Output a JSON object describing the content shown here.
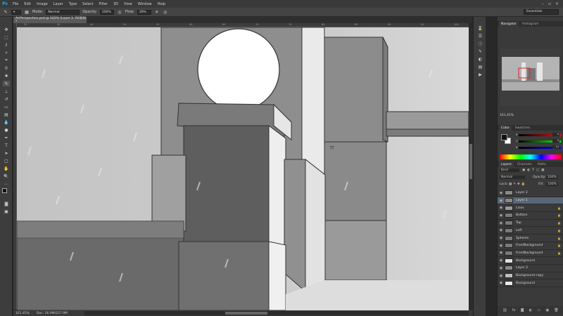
{
  "menubar": {
    "logo": "Ps",
    "items": [
      "File",
      "Edit",
      "Image",
      "Layer",
      "Type",
      "Select",
      "Filter",
      "3D",
      "View",
      "Window",
      "Help"
    ],
    "window_controls": [
      "–",
      "▫",
      "×"
    ]
  },
  "options_bar": {
    "mode_label": "Mode:",
    "mode_value": "Normal",
    "opacity_label": "Opacity:",
    "opacity_value": "100%",
    "flow_label": "Flow:",
    "flow_value": "30%",
    "workspace": "Essentials"
  },
  "document": {
    "tab_title": "AirPerspective.psd @ 162% (Layer 2, RGB/8) *",
    "zoom": "161.45%",
    "doc_size": "Doc: 26.9M/227.9M"
  },
  "ruler": {
    "ticks": [
      "35",
      "40",
      "45",
      "50",
      "55",
      "60",
      "65",
      "70",
      "75",
      "80",
      "85",
      "90",
      "95",
      "100"
    ]
  },
  "navigator": {
    "tabs": [
      "Navigator",
      "Histogram"
    ],
    "zoom": "161.45%"
  },
  "color_panel": {
    "tabs": [
      "Color",
      "Swatches"
    ],
    "channels": [
      {
        "name": "R",
        "value": "0"
      },
      {
        "name": "G",
        "value": "0"
      },
      {
        "name": "B",
        "value": "14"
      }
    ],
    "fg_color": "#111111",
    "bg_color": "#ffffff"
  },
  "layers_panel": {
    "tabs": [
      "Layers",
      "Channels",
      "Paths"
    ],
    "kind": "Kind",
    "blend_mode": "Normal",
    "opacity_label": "Opacity:",
    "opacity_value": "100%",
    "lock_label": "Lock:",
    "fill_label": "Fill:",
    "fill_value": "100%",
    "layers": [
      {
        "name": "Layer 2",
        "thumb": "#8a8a8a",
        "selected": false,
        "locked": false
      },
      {
        "name": "Layer 1",
        "thumb": "#8a8a8a",
        "selected": true,
        "locked": false
      },
      {
        "name": "Lines",
        "thumb": "#999999",
        "selected": false,
        "locked": true
      },
      {
        "name": "Bottom",
        "thumb": "#7a7a7a",
        "selected": false,
        "locked": true
      },
      {
        "name": "Top",
        "thumb": "#7a7a7a",
        "selected": false,
        "locked": true
      },
      {
        "name": "Left",
        "thumb": "#7a7a7a",
        "selected": false,
        "locked": true
      },
      {
        "name": "Spheres",
        "thumb": "#7a7a7a",
        "selected": false,
        "locked": true
      },
      {
        "name": "FrontBackground",
        "thumb": "#7a7a7a",
        "selected": false,
        "locked": true
      },
      {
        "name": "FrontBackground",
        "thumb": "#7a7a7a",
        "selected": false,
        "locked": true
      },
      {
        "name": "Background",
        "thumb": "#e0e0e0",
        "selected": false,
        "locked": false
      },
      {
        "name": "Layer 3",
        "thumb": "#8a8a8a",
        "selected": false,
        "locked": false
      },
      {
        "name": "Background copy",
        "thumb": "#bdbdbd",
        "selected": false,
        "locked": false
      },
      {
        "name": "Background",
        "thumb": "#e8e8e8",
        "selected": false,
        "locked": false
      }
    ]
  }
}
